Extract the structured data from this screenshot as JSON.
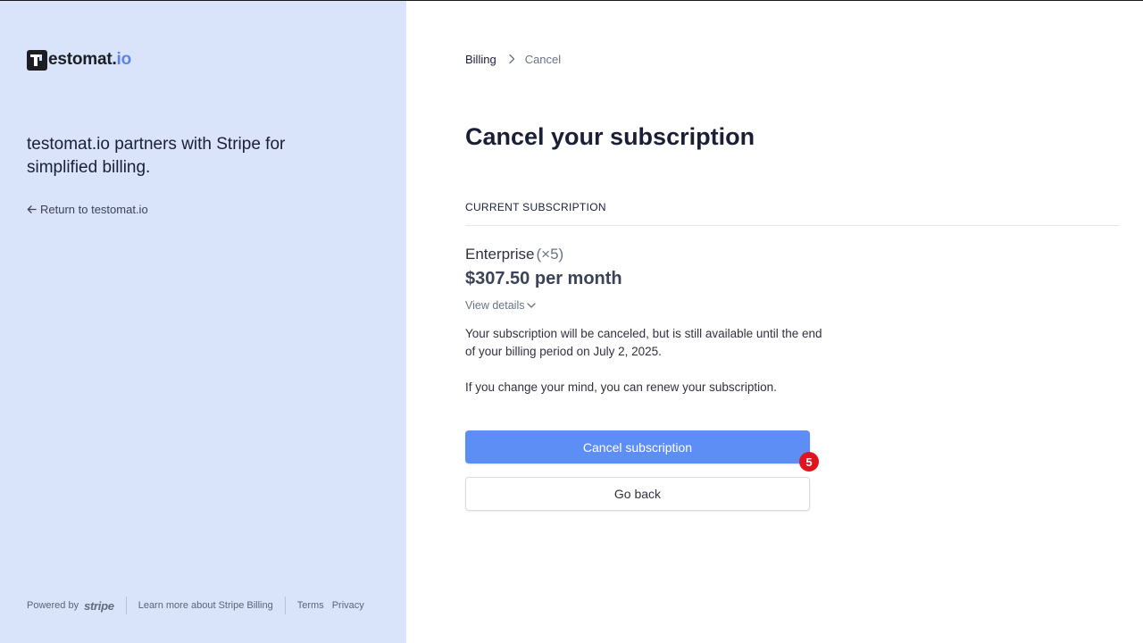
{
  "brand": {
    "logo_text_main": "estomat.",
    "logo_text_accent": "io"
  },
  "left": {
    "tagline": "testomat.io partners with Stripe for simplified billing.",
    "return_link": "Return to testomat.io",
    "footer": {
      "powered_by": "Powered by",
      "stripe": "stripe",
      "learn_more": "Learn more about Stripe Billing",
      "terms": "Terms",
      "privacy": "Privacy"
    }
  },
  "breadcrumb": {
    "billing": "Billing",
    "current": "Cancel"
  },
  "main": {
    "title": "Cancel your subscription",
    "section_label": "CURRENT SUBSCRIPTION",
    "plan_name": "Enterprise",
    "plan_qty": "(×5)",
    "price": "$307.50 per month",
    "view_details": "View details",
    "notice": "Your subscription will be canceled, but is still available until the end of your billing period on July 2, 2025.",
    "notice2": "If you change your mind, you can renew your subscription.",
    "cancel_button": "Cancel subscription",
    "back_button": "Go back"
  },
  "annotation": {
    "badge": "5"
  },
  "colors": {
    "left_panel_bg": "#d9e3f9",
    "primary_button": "#5c8ef6",
    "logo_accent": "#5c84e8",
    "badge": "#e0141e"
  }
}
